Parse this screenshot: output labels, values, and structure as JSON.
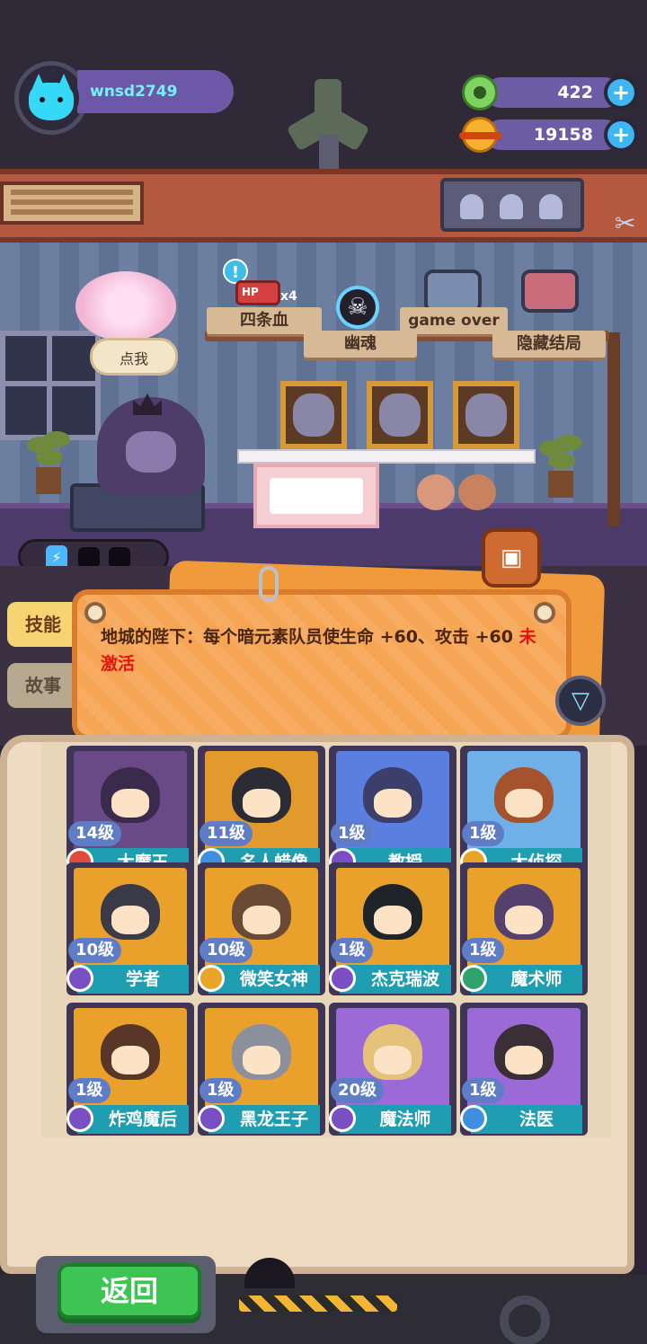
{
  "player": {
    "username": "wnsd2749",
    "avatar_icon": "cat-face-icon"
  },
  "resources": {
    "gems": {
      "value": "422",
      "icon": "gem-icon"
    },
    "coins": {
      "value": "19158",
      "icon": "planet-coin-icon"
    }
  },
  "room": {
    "speech_bubble": "点我",
    "hp_badge": "HP",
    "hp_multiplier": "x4",
    "shelf_tags": [
      "四条血",
      "幽魂",
      "game over",
      "隐藏结局"
    ]
  },
  "tabs": {
    "skill": "技能",
    "story": "故事"
  },
  "skill_panel": {
    "description": "地城的陛下：每个暗元素队员使生命 +60、攻击 +60",
    "status": "未激活"
  },
  "heroes": [
    {
      "level": "14级",
      "name": "大魔王",
      "rank_color": "#e24b3c",
      "art_color": "#6a4a86",
      "hair": "#3a2a4c"
    },
    {
      "level": "11级",
      "name": "名人蜡像",
      "rank_color": "#3f8fe0",
      "art_color": "#e39a2c",
      "hair": "#2c2c36"
    },
    {
      "level": "1级",
      "name": "教授",
      "rank_color": "#7a4fc3",
      "art_color": "#5b7fe0",
      "hair": "#3b3f69"
    },
    {
      "level": "1级",
      "name": "大侦探",
      "rank_color": "#e8a528",
      "art_color": "#6fb0e8",
      "hair": "#a4532c"
    },
    {
      "level": "10级",
      "name": "学者",
      "rank_color": "#7a4fc3",
      "art_color": "#e9a12c",
      "hair": "#3a3a48"
    },
    {
      "level": "10级",
      "name": "微笑女神",
      "rank_color": "#e8a528",
      "art_color": "#e9a12c",
      "hair": "#6b4a35"
    },
    {
      "level": "1级",
      "name": "杰克瑞波",
      "rank_color": "#7a4fc3",
      "art_color": "#e9a12c",
      "hair": "#1e2428"
    },
    {
      "level": "1级",
      "name": "魔术师",
      "rank_color": "#2fa36b",
      "art_color": "#e9a12c",
      "hair": "#55406e"
    },
    {
      "level": "1级",
      "name": "炸鸡魔后",
      "rank_color": "#7a4fc3",
      "art_color": "#e9a12c",
      "hair": "#5a3628"
    },
    {
      "level": "1级",
      "name": "黑龙王子",
      "rank_color": "#7a4fc3",
      "art_color": "#e9a12c",
      "hair": "#8c8f9c"
    },
    {
      "level": "20级",
      "name": "魔法师",
      "rank_color": "#7a4fc3",
      "art_color": "#9b6ad6",
      "hair": "#e4c27a"
    },
    {
      "level": "1级",
      "name": "法医",
      "rank_color": "#3f8fe0",
      "art_color": "#9b6ad6",
      "hair": "#3a2f35"
    }
  ],
  "footer": {
    "back_label": "返回"
  },
  "colors": {
    "accent": "#3fb5f2",
    "back_button": "#3dc453",
    "scroll": "#f6a554"
  }
}
